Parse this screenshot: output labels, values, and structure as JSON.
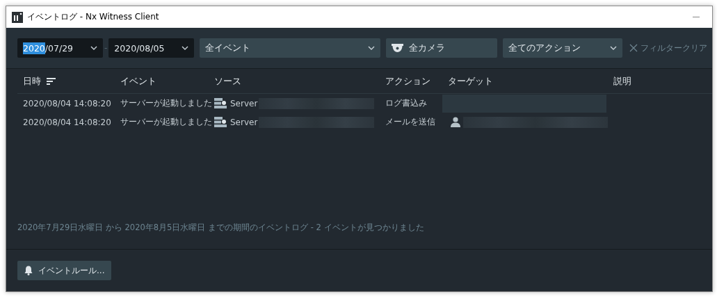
{
  "window": {
    "title": "イベントログ - Nx Witness Client"
  },
  "filters": {
    "date_from": {
      "selected_text": "2020",
      "rest": "/07/29"
    },
    "date_separator": "-",
    "date_to": "2020/08/05",
    "event_type": "全イベント",
    "camera": "全カメラ",
    "action_type": "全てのアクション",
    "clear": "フィルタークリア"
  },
  "table": {
    "columns": [
      {
        "label": "日時",
        "sorted": true
      },
      {
        "label": "イベント",
        "sorted": false
      },
      {
        "label": "ソース",
        "sorted": false
      },
      {
        "label": "アクション",
        "sorted": false
      },
      {
        "label": "ターゲット",
        "sorted": false
      },
      {
        "label": "説明",
        "sorted": false
      }
    ],
    "rows": [
      {
        "time": "2020/08/04 14:08:20",
        "event": "サーバーが起動しました",
        "source": "Server",
        "action": "ログ書込み",
        "kind": "plain"
      },
      {
        "time": "2020/08/04 14:08:20",
        "event": "サーバーが起動しました",
        "source": "Server",
        "action": "メールを送信",
        "kind": "user"
      }
    ]
  },
  "status": "2020年7月29日水曜日 から 2020年8月5日水曜日 までの期間のイベントログ - 2 イベントが見つかりました",
  "buttons": [
    {
      "label": "イベントルール..."
    }
  ]
}
